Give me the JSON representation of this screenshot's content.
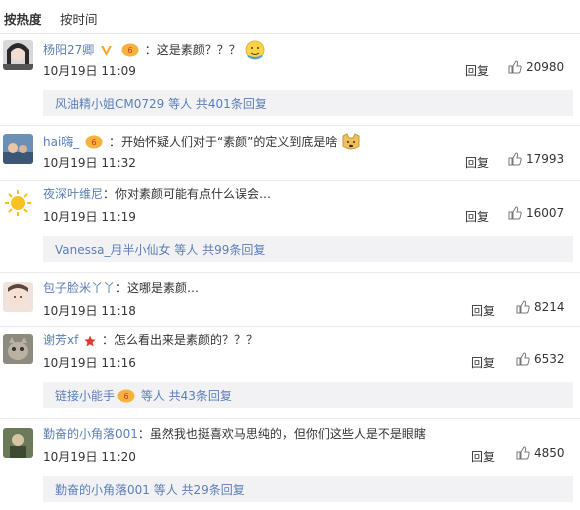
{
  "sort": {
    "hot_label": "按热度",
    "time_label": "按时间"
  },
  "comments": [
    {
      "user": "杨阳27卿",
      "text": "：这是素颜？？？",
      "date": "10月19日 11:09",
      "reply_label": "回复",
      "likes": "20980",
      "sub": {
        "user": "风油精小姐CM0729",
        "rest": " 等人 共401条回复"
      }
    },
    {
      "user": "hai嗨_",
      "text": "：开始怀疑人们对于“素颜”的定义到底是啥",
      "date": "10月19日 11:32",
      "reply_label": "回复",
      "likes": "17993"
    },
    {
      "user": "夜深叶维尼",
      "text": "：你对素颜可能有点什么误会…",
      "date": "10月19日 11:19",
      "reply_label": "回复",
      "likes": "16007",
      "sub": {
        "user": "Vanessa_月半小仙女",
        "rest": " 等人 共99条回复"
      }
    },
    {
      "user": "包子脸米丫丫",
      "text": "：这哪是素颜…",
      "date": "10月19日 11:18",
      "reply_label": "回复",
      "likes": "8214"
    },
    {
      "user": "谢芳xf",
      "text": "：怎么看出来是素颜的？？？",
      "date": "10月19日 11:16",
      "reply_label": "回复",
      "likes": "6532",
      "sub": {
        "user": "链接小能手",
        "rest": " 等人 共43条回复"
      }
    },
    {
      "user": "勤奋的小角落001",
      "text": "：虽然我也挺喜欢马思纯的，但你们这些人是不是眼瞎",
      "date": "10月19日 11:20",
      "reply_label": "回复",
      "likes": "4850",
      "sub": {
        "user": "勤奋的小角落001",
        "rest": " 等人 共29条回复"
      }
    }
  ],
  "colors": {
    "link": "#5a7eb5",
    "text": "#333333",
    "subbox_bg": "#f2f2f5"
  }
}
